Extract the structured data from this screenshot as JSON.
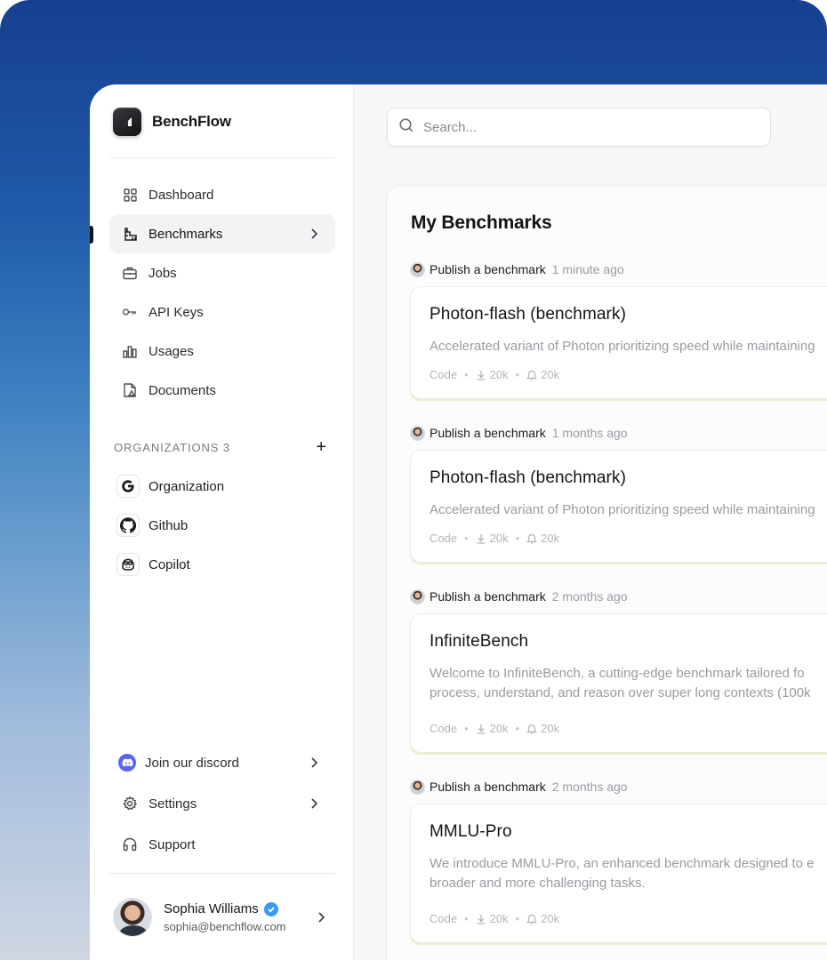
{
  "brand": {
    "name": "BenchFlow"
  },
  "nav": {
    "items": [
      {
        "label": "Dashboard",
        "icon": "grid-icon"
      },
      {
        "label": "Benchmarks",
        "icon": "ruler-icon",
        "active": true
      },
      {
        "label": "Jobs",
        "icon": "briefcase-icon"
      },
      {
        "label": "API Keys",
        "icon": "key-icon"
      },
      {
        "label": "Usages",
        "icon": "bar-chart-icon"
      },
      {
        "label": "Documents",
        "icon": "document-icon"
      }
    ]
  },
  "organizations": {
    "header": "ORGANIZATIONS 3",
    "add_label": "+",
    "items": [
      {
        "label": "Organization",
        "icon": "google-icon"
      },
      {
        "label": "Github",
        "icon": "github-icon"
      },
      {
        "label": "Copilot",
        "icon": "copilot-icon"
      }
    ]
  },
  "bottom": {
    "discord": "Join our discord",
    "settings": "Settings",
    "support": "Support"
  },
  "user": {
    "name": "Sophia Williams",
    "email": "sophia@benchflow.com"
  },
  "search": {
    "placeholder": "Search..."
  },
  "main": {
    "title": "My Benchmarks",
    "entries": [
      {
        "action": "Publish a benchmark",
        "time": "1 minute ago",
        "title": "Photon-flash (benchmark)",
        "desc": "Accelerated variant of Photon prioritizing speed while maintaining",
        "meta": {
          "code": "Code",
          "downloads": "20k",
          "likes": "20k"
        }
      },
      {
        "action": "Publish a benchmark",
        "time": "1 months ago",
        "title": "Photon-flash (benchmark)",
        "desc": "Accelerated variant of Photon prioritizing speed while maintaining",
        "meta": {
          "code": "Code",
          "downloads": "20k",
          "likes": "20k"
        }
      },
      {
        "action": "Publish a benchmark",
        "time": "2 months ago",
        "title": "InfiniteBench",
        "desc": "Welcome to InfiniteBench, a cutting-edge benchmark tailored fo\nprocess, understand, and reason over super long contexts (100k",
        "meta": {
          "code": "Code",
          "downloads": "20k",
          "likes": "20k"
        }
      },
      {
        "action": "Publish a benchmark",
        "time": "2 months ago",
        "title": "MMLU-Pro",
        "desc": "We introduce MMLU-Pro, an enhanced benchmark designed to e\nbroader and more challenging tasks.",
        "meta": {
          "code": "Code",
          "downloads": "20k",
          "likes": "20k"
        }
      }
    ]
  }
}
